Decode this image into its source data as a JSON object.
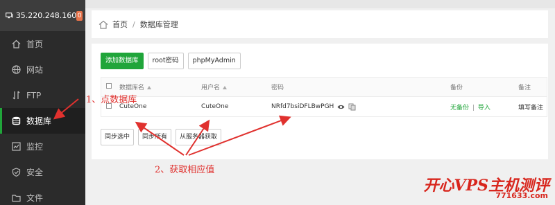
{
  "sidebar": {
    "server_ip": "35.220.248.160",
    "badge": "0",
    "items": [
      {
        "label": "首页",
        "icon": "home-icon"
      },
      {
        "label": "网站",
        "icon": "globe-icon"
      },
      {
        "label": "FTP",
        "icon": "ftp-icon"
      },
      {
        "label": "数据库",
        "icon": "database-icon",
        "active": true
      },
      {
        "label": "监控",
        "icon": "monitor-icon"
      },
      {
        "label": "安全",
        "icon": "shield-icon"
      },
      {
        "label": "文件",
        "icon": "folder-icon"
      }
    ]
  },
  "breadcrumb": {
    "home": "首页",
    "separator": "/",
    "current": "数据库管理"
  },
  "toolbar": {
    "add_db": "添加数据库",
    "root_pwd": "root密码",
    "phpmyadmin": "phpMyAdmin"
  },
  "table": {
    "headers": {
      "name": "数据库名",
      "user": "用户名",
      "password": "密码",
      "backup": "备份",
      "note": "备注"
    },
    "rows": [
      {
        "name": "CuteOne",
        "user": "CuteOne",
        "password": "NRfd7bsiDFLBwPGH",
        "backup_none": "无备份",
        "backup_sep": "|",
        "backup_import": "导入",
        "note": "填写备注"
      }
    ]
  },
  "bottom_buttons": {
    "sync_selected": "同步选中",
    "sync_all": "同步所有",
    "from_server": "从服务器获取"
  },
  "annotations": {
    "step1": "1、点数据库",
    "step2": "2、获取相应值"
  },
  "watermark": {
    "title": "开心VPS主机测评",
    "url": "771633.com"
  },
  "colors": {
    "accent_green": "#20a53a",
    "annotation_red": "#e0312e",
    "sidebar_bg": "#2b2b2b"
  }
}
